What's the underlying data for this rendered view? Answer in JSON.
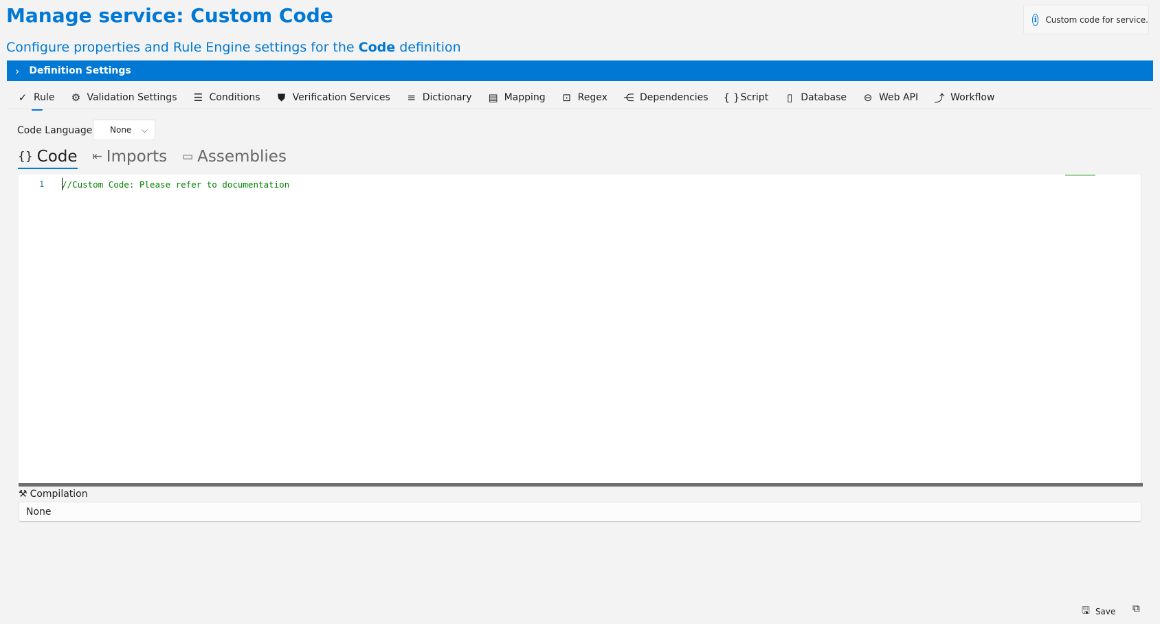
{
  "header": {
    "title": "Manage service:  Custom Code",
    "subtitle_prefix": "Configure properties and Rule Engine settings for the",
    "subtitle_bold": "Code",
    "subtitle_suffix": "definition"
  },
  "info": {
    "text": "Custom code for service."
  },
  "definition_bar": {
    "label": "Definition Settings"
  },
  "tabs": [
    {
      "label": "Rule",
      "icon": "check-icon",
      "glyph": "✓"
    },
    {
      "label": "Validation Settings",
      "icon": "validation-icon",
      "glyph": "⚙"
    },
    {
      "label": "Conditions",
      "icon": "conditions-icon",
      "glyph": "☰"
    },
    {
      "label": "Verification Services",
      "icon": "shield-icon",
      "glyph": "⛊"
    },
    {
      "label": "Dictionary",
      "icon": "list-icon",
      "glyph": "≡"
    },
    {
      "label": "Mapping",
      "icon": "mapping-icon",
      "glyph": "▤"
    },
    {
      "label": "Regex",
      "icon": "regex-icon",
      "glyph": "⊡"
    },
    {
      "label": "Dependencies",
      "icon": "share-icon",
      "glyph": "⋲"
    },
    {
      "label": "Script",
      "icon": "braces-icon",
      "glyph": "{ }"
    },
    {
      "label": "Database",
      "icon": "database-icon",
      "glyph": "▯"
    },
    {
      "label": "Web API",
      "icon": "web-api-icon",
      "glyph": "⊖"
    },
    {
      "label": "Workflow",
      "icon": "workflow-icon",
      "glyph": "⤴"
    }
  ],
  "code_language": {
    "label": "Code Language:",
    "value": "None"
  },
  "subtabs": [
    {
      "label": "Code",
      "icon": "braces-icon",
      "glyph": "{}"
    },
    {
      "label": "Imports",
      "icon": "imports-icon",
      "glyph": "⇤"
    },
    {
      "label": "Assemblies",
      "icon": "assemblies-icon",
      "glyph": "▭"
    }
  ],
  "editor": {
    "line_number": "1",
    "line_text": "//Custom Code: Please refer to documentation"
  },
  "compilation": {
    "label": "Compilation",
    "value": "None"
  },
  "footer": {
    "save_label": "Save"
  },
  "colors": {
    "accent": "#0078d4",
    "comment": "#008000"
  }
}
